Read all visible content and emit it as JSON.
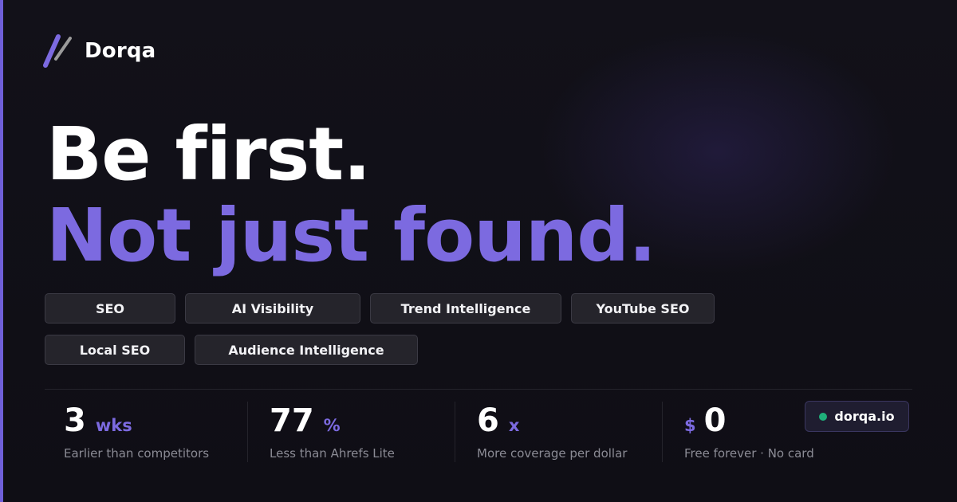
{
  "brand": {
    "name": "Dorqa",
    "logo_icon": "double-slash-logo-icon"
  },
  "hero": {
    "line1": "Be first.",
    "line2": "Not just found."
  },
  "features": [
    "SEO",
    "AI Visibility",
    "Trend Intelligence",
    "YouTube SEO",
    "Local SEO",
    "Audience Intelligence"
  ],
  "stats": [
    {
      "value": "3",
      "unit": "wks",
      "label": "Earlier than competitors"
    },
    {
      "value": "77",
      "unit": "%",
      "label": "Less than Ahrefs Lite"
    },
    {
      "value": "6",
      "unit": "x",
      "label": "More coverage per dollar"
    },
    {
      "prefix": "$",
      "value": "0",
      "label": "Free forever · No card"
    }
  ],
  "url_badge": {
    "text": "dorqa.io",
    "status_color": "#1fb07a"
  },
  "colors": {
    "accent": "#7c6ae0",
    "background": "#0f0e15",
    "chip_bg": "#25242b"
  }
}
